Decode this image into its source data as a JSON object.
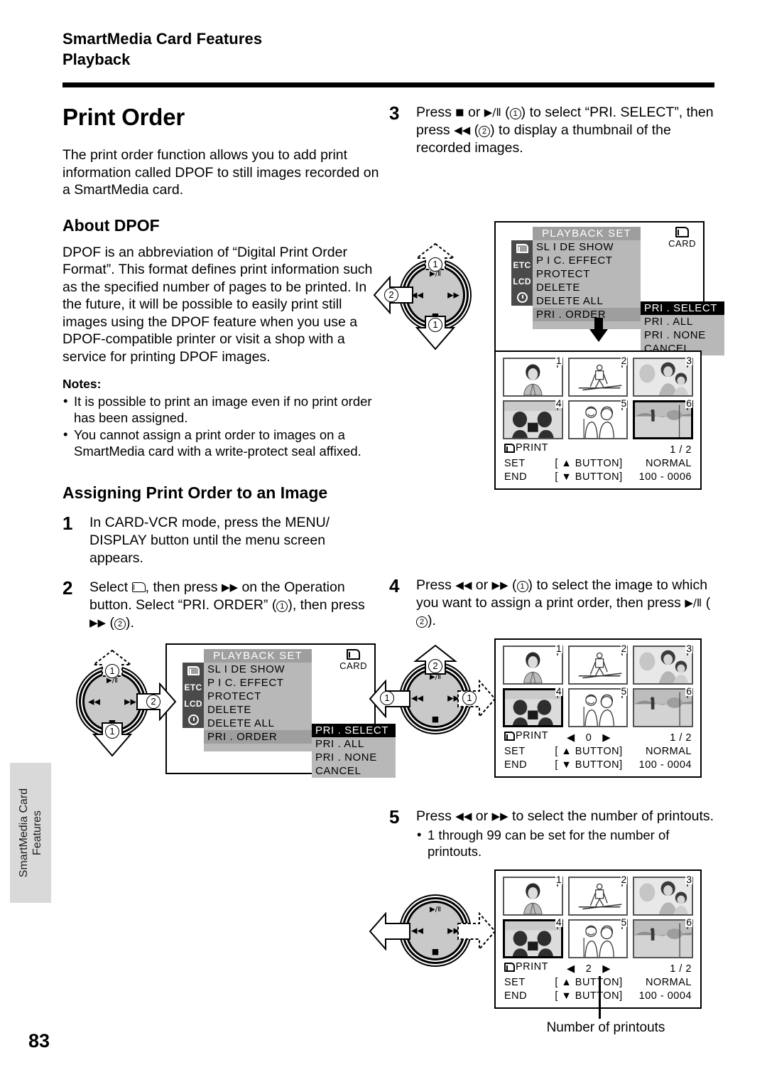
{
  "header": {
    "line1": "SmartMedia Card Features",
    "line2": "Playback"
  },
  "side_tab": {
    "line1": "SmartMedia Card",
    "line2": "Features"
  },
  "page_number": "83",
  "left_column": {
    "title": "Print Order",
    "intro": "The print order function allows you to add print information called DPOF to still images recorded on a SmartMedia card.",
    "about_heading": "About DPOF",
    "about_body": "DPOF is an abbreviation of “Digital Print Order Format”. This format defines print information such as the specified number of pages to be printed. In the future, it will be possible to easily print still images using the DPOF feature when you use a DPOF-compatible printer or visit a shop with a service for printing DPOF images.",
    "notes_label": "Notes:",
    "notes": [
      "It is possible to print an image even if no print order has been assigned.",
      "You cannot assign a print order to images on a SmartMedia card with a write-protect seal affixed."
    ],
    "assign_heading": "Assigning Print Order to an Image",
    "step1": {
      "number": "1",
      "text": "In CARD-VCR mode, press the MENU/ DISPLAY button until the menu screen appears."
    },
    "step2": {
      "number": "2",
      "part1": "Select",
      "part2": ", then press",
      "part3": "on the Operation button. Select “PRI. ORDER” (",
      "part4": "), then press",
      "part5": "(",
      "part6": ").",
      "badge1": "1",
      "badge2": "2"
    }
  },
  "right_column": {
    "step3": {
      "number": "3",
      "part1": "Press",
      "part2": "or",
      "part3": "(",
      "part4": ") to select “PRI. SELECT”, then press",
      "part5": "(",
      "part6": ") to display a thumbnail of the recorded images.",
      "badge1": "1",
      "badge2": "2"
    },
    "step4": {
      "number": "4",
      "part1": "Press",
      "part2": "or",
      "part3": "(",
      "part4": ") to select the image to which you want to assign a print order, then press",
      "part5": "(",
      "part6": ").",
      "badge1": "1",
      "badge2": "2"
    },
    "step5": {
      "number": "5",
      "part1": "Press",
      "part2": "or",
      "part3": "to select the number of printouts.",
      "bullet": "1 through 99 can be set for the number of printouts."
    },
    "caption": "Number of printouts"
  },
  "lcd_menu": {
    "title": "PLAYBACK  SET",
    "side_icons": [
      "card-icon",
      "ETC",
      "LCD",
      "clock-icon"
    ],
    "items": [
      "SL I DE  SHOW",
      "P I C. EFFECT",
      "PROTECT",
      "DELETE",
      "DELETE  ALL",
      "PRI . ORDER"
    ],
    "selected_item": "PRI . ORDER",
    "submenu": [
      "PRI . SELECT",
      "PRI . ALL",
      "PRI . NONE",
      "CANCEL"
    ],
    "submenu_highlighted": "PRI . SELECT",
    "card_indicator": "CARD"
  },
  "thumbnails": {
    "indices": [
      "1",
      "2",
      "3",
      "4",
      "5",
      "6"
    ],
    "screen_step3": {
      "print_label": "PRINT",
      "count": "",
      "page": "1 / 2",
      "set_label": "SET",
      "set_button": "[ ▲  BUTTON]",
      "quality": "NORMAL",
      "end_label": "END",
      "end_button": "[ ▼  BUTTON]",
      "file": "100 - 0006",
      "selected": 0
    },
    "screen_step4": {
      "print_label": "PRINT",
      "count": "0",
      "page": "1 / 2",
      "set_label": "SET",
      "set_button": "[ ▲  BUTTON]",
      "quality": "NORMAL",
      "end_label": "END",
      "end_button": "[ ▼  BUTTON]",
      "file": "100 - 0004",
      "selected": 4
    },
    "screen_step5": {
      "print_label": "PRINT",
      "count": "2",
      "page": "1 / 2",
      "set_label": "SET",
      "set_button": "[ ▲  BUTTON]",
      "quality": "NORMAL",
      "end_label": "END",
      "end_button": "[ ▼  BUTTON]",
      "file": "100 - 0004",
      "selected": 4
    }
  },
  "dial": {
    "glyph_play": "▶/Ⅱ",
    "glyph_stop": "■",
    "glyph_rew": "◀◀",
    "glyph_ff": "▶▶"
  },
  "colors": {
    "ink": "#000000",
    "lcd_list_bg": "#b8b8b8",
    "lcd_sel_bg": "#9e9e9e",
    "lcd_icon_bg": "#4a4a4a",
    "tab_bg": "#d9d9d9"
  }
}
